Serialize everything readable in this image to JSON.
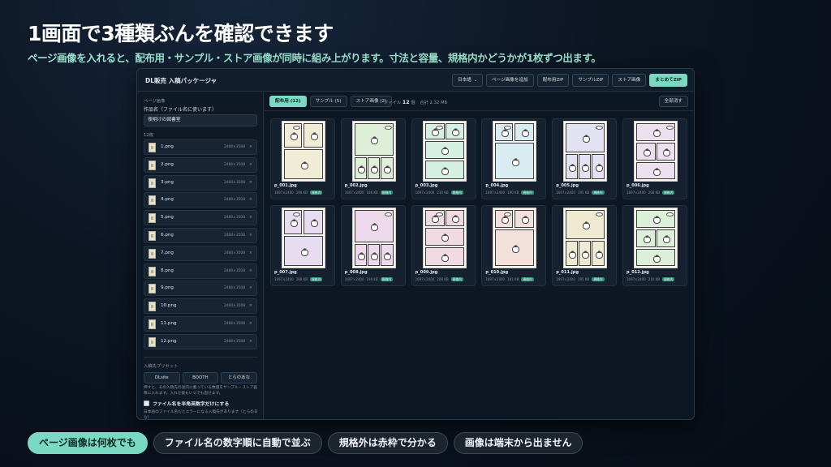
{
  "hero": {
    "headline": "1画面で3種類ぶんを確認できます",
    "subline": "ページ画像を入れると、配布用・サンプル・ストア画像が同時に組み上がります。寸法と容量、規格内かどうかが1枚ずつ出ます。"
  },
  "app": {
    "title": "DL販売 入稿パッケージャ",
    "toolbar": {
      "language": "日本語",
      "add_pages": "ページ画像を追加",
      "zip_distribution": "配布用ZIP",
      "zip_sample": "サンプルZIP",
      "store_images": "ストア画像",
      "zip_all": "まとめてZIP"
    }
  },
  "sidebar": {
    "section_label": "ページ画像",
    "work_name_label": "作品名（ファイル名に使います）",
    "work_name_value": "夜明けの図書室",
    "count_label": "12枚",
    "files": [
      {
        "name": "1.png",
        "dims": "2480×3508"
      },
      {
        "name": "2.png",
        "dims": "2480×3508"
      },
      {
        "name": "3.png",
        "dims": "2480×3508"
      },
      {
        "name": "4.png",
        "dims": "2480×3508"
      },
      {
        "name": "5.png",
        "dims": "2480×3508"
      },
      {
        "name": "6.png",
        "dims": "2480×3508"
      },
      {
        "name": "7.png",
        "dims": "2480×3508"
      },
      {
        "name": "8.png",
        "dims": "2480×3508"
      },
      {
        "name": "9.png",
        "dims": "2480×3508"
      },
      {
        "name": "10.png",
        "dims": "2480×3508"
      },
      {
        "name": "11.png",
        "dims": "2480×3508"
      },
      {
        "name": "12.png",
        "dims": "2480×3508"
      }
    ],
    "remove_glyph": "×",
    "preset_label": "入稿先プリセット",
    "presets": [
      "DLsite",
      "BOOTH",
      "とらのあな"
    ],
    "preset_note": "押すと、その入稿先の案内に載っている数値をサンプル・ストア画像に入れます。入れた後もいつでも直せます。",
    "halfwidth_label": "ファイル名を半角英数字だけにする",
    "halfwidth_note": "日本語のファイル名だとエラーになる入稿先があります（とらのあな）"
  },
  "main": {
    "tabs": [
      "配布用 (12)",
      "サンプル (5)",
      "ストア画像 (2)"
    ],
    "stats_prefix": "ファイル",
    "stats_count": "12",
    "stats_unit": "個",
    "stats_total": "合計 2.32 MB",
    "clear_all": "全部消す",
    "badge_text": "規格内",
    "cards": [
      {
        "name": "p_001.jpg",
        "dims": "1697×2400",
        "size": "190 KB",
        "tint": "#f1ecd5"
      },
      {
        "name": "p_002.jpg",
        "dims": "1697×2400",
        "size": "196 KB",
        "tint": "#dfeed7"
      },
      {
        "name": "p_003.jpg",
        "dims": "1697×2400",
        "size": "210 KB",
        "tint": "#d6efe3"
      },
      {
        "name": "p_004.jpg",
        "dims": "1697×2400",
        "size": "190 KB",
        "tint": "#d8ecf2"
      },
      {
        "name": "p_005.jpg",
        "dims": "1697×2400",
        "size": "195 KB",
        "tint": "#e3e2f2"
      },
      {
        "name": "p_006.jpg",
        "dims": "1697×2400",
        "size": "208 KB",
        "tint": "#ece0ee"
      },
      {
        "name": "p_007.jpg",
        "dims": "1697×2400",
        "size": "188 KB",
        "tint": "#e8dcf0"
      },
      {
        "name": "p_008.jpg",
        "dims": "1697×2400",
        "size": "194 KB",
        "tint": "#eed9ec"
      },
      {
        "name": "p_009.jpg",
        "dims": "1697×2400",
        "size": "208 KB",
        "tint": "#f1dbe2"
      },
      {
        "name": "p_010.jpg",
        "dims": "1697×2400",
        "size": "181 KB",
        "tint": "#f3e0da"
      },
      {
        "name": "p_011.jpg",
        "dims": "1697×2400",
        "size": "195 KB",
        "tint": "#f0ead2"
      },
      {
        "name": "p_012.jpg",
        "dims": "1697×2400",
        "size": "210 KB",
        "tint": "#dcefd9"
      }
    ]
  },
  "pills": [
    "ページ画像は何枚でも",
    "ファイル名の数字順に自動で並ぶ",
    "規格外は赤枠で分かる",
    "画像は端末から出ません"
  ]
}
